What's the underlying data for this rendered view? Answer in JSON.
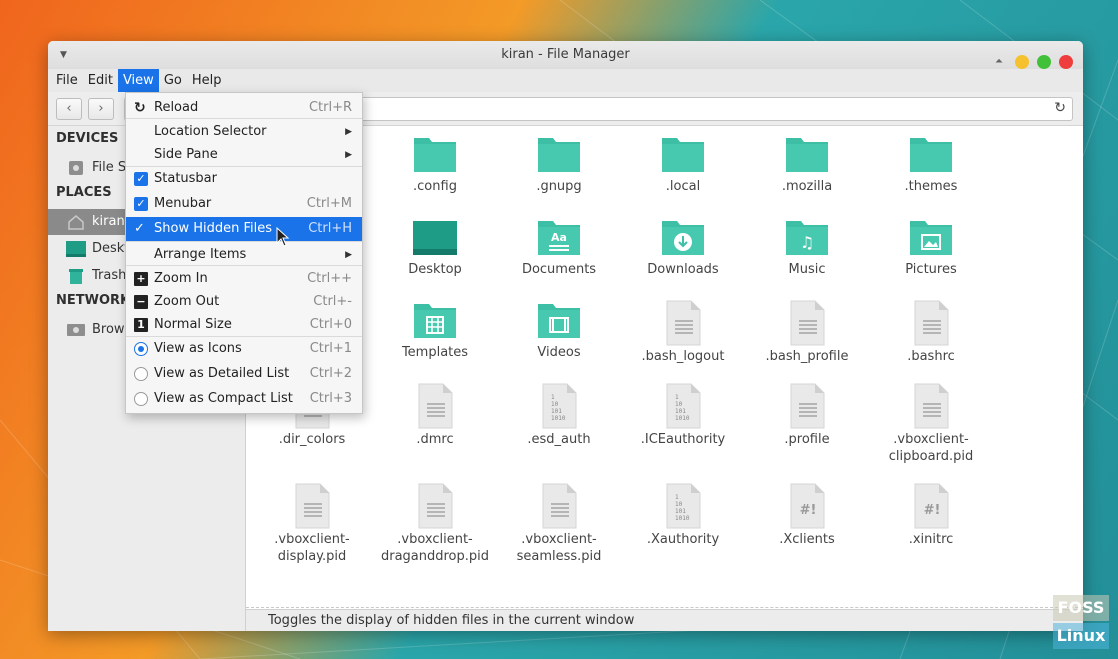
{
  "window": {
    "title": "kiran - File Manager"
  },
  "menubar": {
    "items": [
      "File",
      "Edit",
      "View",
      "Go",
      "Help"
    ],
    "active": "View"
  },
  "sidebar": {
    "devices_header": "DEVICES",
    "device_item": "File S",
    "places_header": "PLACES",
    "places": [
      "kiran",
      "Deskt",
      "Trash"
    ],
    "network_header": "NETWORK",
    "network_item": "Brow"
  },
  "view_menu": {
    "items": [
      {
        "label": "Reload",
        "accel": "Ctrl+R",
        "mark": "reload"
      },
      {
        "label": "Location Selector",
        "accel": "",
        "mark": "submenu"
      },
      {
        "label": "Side Pane",
        "accel": "",
        "mark": "submenu"
      },
      {
        "label": "Statusbar",
        "accel": "",
        "mark": "checkbox"
      },
      {
        "label": "Menubar",
        "accel": "Ctrl+M",
        "mark": "checkbox"
      },
      {
        "label": "Show Hidden Files",
        "accel": "Ctrl+H",
        "mark": "check",
        "highlighted": true
      },
      {
        "label": "Arrange Items",
        "accel": "",
        "mark": "submenu"
      },
      {
        "label": "Zoom In",
        "accel": "Ctrl++",
        "mark": "plus"
      },
      {
        "label": "Zoom Out",
        "accel": "Ctrl+-",
        "mark": "minus"
      },
      {
        "label": "Normal Size",
        "accel": "Ctrl+0",
        "mark": "one"
      },
      {
        "label": "View as Icons",
        "accel": "Ctrl+1",
        "mark": "radio-on"
      },
      {
        "label": "View as Detailed List",
        "accel": "Ctrl+2",
        "mark": "radio"
      },
      {
        "label": "View as Compact List",
        "accel": "Ctrl+3",
        "mark": "radio"
      }
    ]
  },
  "files": [
    {
      "name": ".config",
      "icon": "folder"
    },
    {
      "name": ".gnupg",
      "icon": "folder"
    },
    {
      "name": ".local",
      "icon": "folder"
    },
    {
      "name": ".mozilla",
      "icon": "folder"
    },
    {
      "name": ".themes",
      "icon": "folder"
    },
    {
      "name": "Desktop",
      "icon": "desktop-folder"
    },
    {
      "name": "Documents",
      "icon": "documents-folder"
    },
    {
      "name": "Downloads",
      "icon": "downloads-folder"
    },
    {
      "name": "Music",
      "icon": "music-folder"
    },
    {
      "name": "Pictures",
      "icon": "pictures-folder"
    },
    {
      "name": "Templates",
      "icon": "templates-folder"
    },
    {
      "name": "Videos",
      "icon": "videos-folder"
    },
    {
      "name": ".bash_logout",
      "icon": "text-file"
    },
    {
      "name": ".bash_profile",
      "icon": "text-file"
    },
    {
      "name": ".bashrc",
      "icon": "text-file"
    },
    {
      "name": ".dir_colors",
      "icon": "text-file"
    },
    {
      "name": ".dmrc",
      "icon": "text-file"
    },
    {
      "name": ".esd_auth",
      "icon": "binary-file"
    },
    {
      "name": ".ICEauthority",
      "icon": "binary-file"
    },
    {
      "name": ".profile",
      "icon": "text-file"
    },
    {
      "name": ".vboxclient-clipboard.pid",
      "line1": ".vboxclient-",
      "line2": "clipboard.pid",
      "icon": "text-file"
    },
    {
      "name": ".vboxclient-display.pid",
      "line1": ".vboxclient-",
      "line2": "display.pid",
      "icon": "text-file"
    },
    {
      "name": ".vboxclient-draganddrop.pid",
      "line1": ".vboxclient-",
      "line2": "draganddrop.pid",
      "icon": "text-file"
    },
    {
      "name": ".vboxclient-seamless.pid",
      "line1": ".vboxclient-",
      "line2": "seamless.pid",
      "icon": "text-file"
    },
    {
      "name": ".Xauthority",
      "icon": "binary-file"
    },
    {
      "name": ".Xclients",
      "icon": "script-file"
    },
    {
      "name": ".xinitrc",
      "icon": "script-file"
    }
  ],
  "statusbar": {
    "text": "Toggles the display of hidden files in the current window"
  },
  "watermark": {
    "top": "FOSS",
    "bottom": "Linux"
  },
  "colors": {
    "accent": "#1a73e8",
    "folder": "#3dbfa6"
  }
}
